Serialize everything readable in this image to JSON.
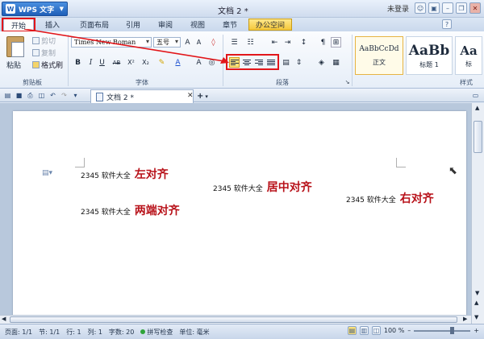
{
  "app": {
    "name": "WPS 文字",
    "doc_title": "文档 2 *",
    "login": "未登录"
  },
  "menu": {
    "tabs": [
      "开始",
      "插入",
      "页面布局",
      "引用",
      "审阅",
      "视图",
      "章节",
      "办公空间"
    ]
  },
  "clipboard": {
    "paste": "粘贴",
    "cut": "剪切",
    "copy": "复制",
    "format_painter": "格式刷",
    "group": "剪贴板"
  },
  "font": {
    "family": "Times New Roman",
    "size": "五号",
    "group": "字体"
  },
  "paragraph": {
    "group": "段落",
    "selected_align": "left"
  },
  "styles": {
    "items": [
      {
        "preview": "AaBbCcDd",
        "name": "正文"
      },
      {
        "preview": "AaBb",
        "name": "标题 1"
      },
      {
        "preview": "Aa",
        "name": "标"
      }
    ],
    "group": "样式"
  },
  "doc_tab": {
    "title": "文档 2 *"
  },
  "content": {
    "lines": [
      {
        "source": "2345 软件大全",
        "text": "左对齐"
      },
      {
        "source": "2345 软件大全",
        "text": "居中对齐"
      },
      {
        "source": "2345 软件大全",
        "text": "右对齐"
      },
      {
        "source": "2345 软件大全",
        "text": "两端对齐"
      }
    ]
  },
  "status": {
    "page": "页面: 1/1",
    "section": "节: 1/1",
    "row": "行: 1",
    "col": "列: 1",
    "words": "字数: 20",
    "spell": "拼写检查",
    "unit": "单位: 毫米",
    "zoom": "100 %"
  },
  "colors": {
    "highlight": "#e2161a",
    "title_text": "#b8121a"
  }
}
